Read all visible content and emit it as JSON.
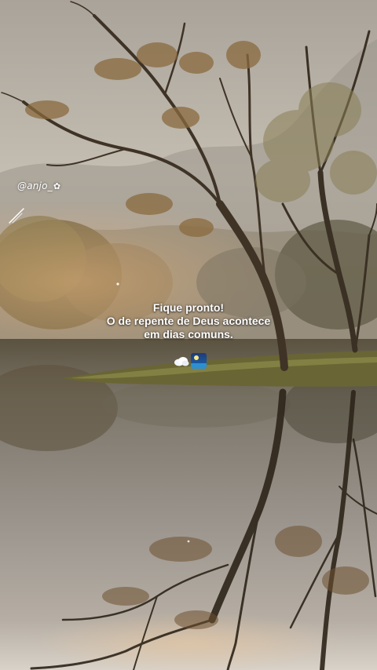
{
  "overlay": {
    "handle": "@anjo_",
    "caption_lines": [
      "Fique pronto!",
      "O de repente de Deus acontece",
      "em dias comuns."
    ]
  },
  "icons": {
    "handle_decoration": "flower-icon",
    "sparkle": "sparkle-icon",
    "emoji_1": "cloud-icon",
    "emoji_2": "night-sky-icon"
  },
  "palette": {
    "sky": "#b9b4ab",
    "haze": "#9a8f7f",
    "foliage_warm": "#8a6a3e",
    "water": "#8f8a82",
    "text": "#ffffff"
  }
}
